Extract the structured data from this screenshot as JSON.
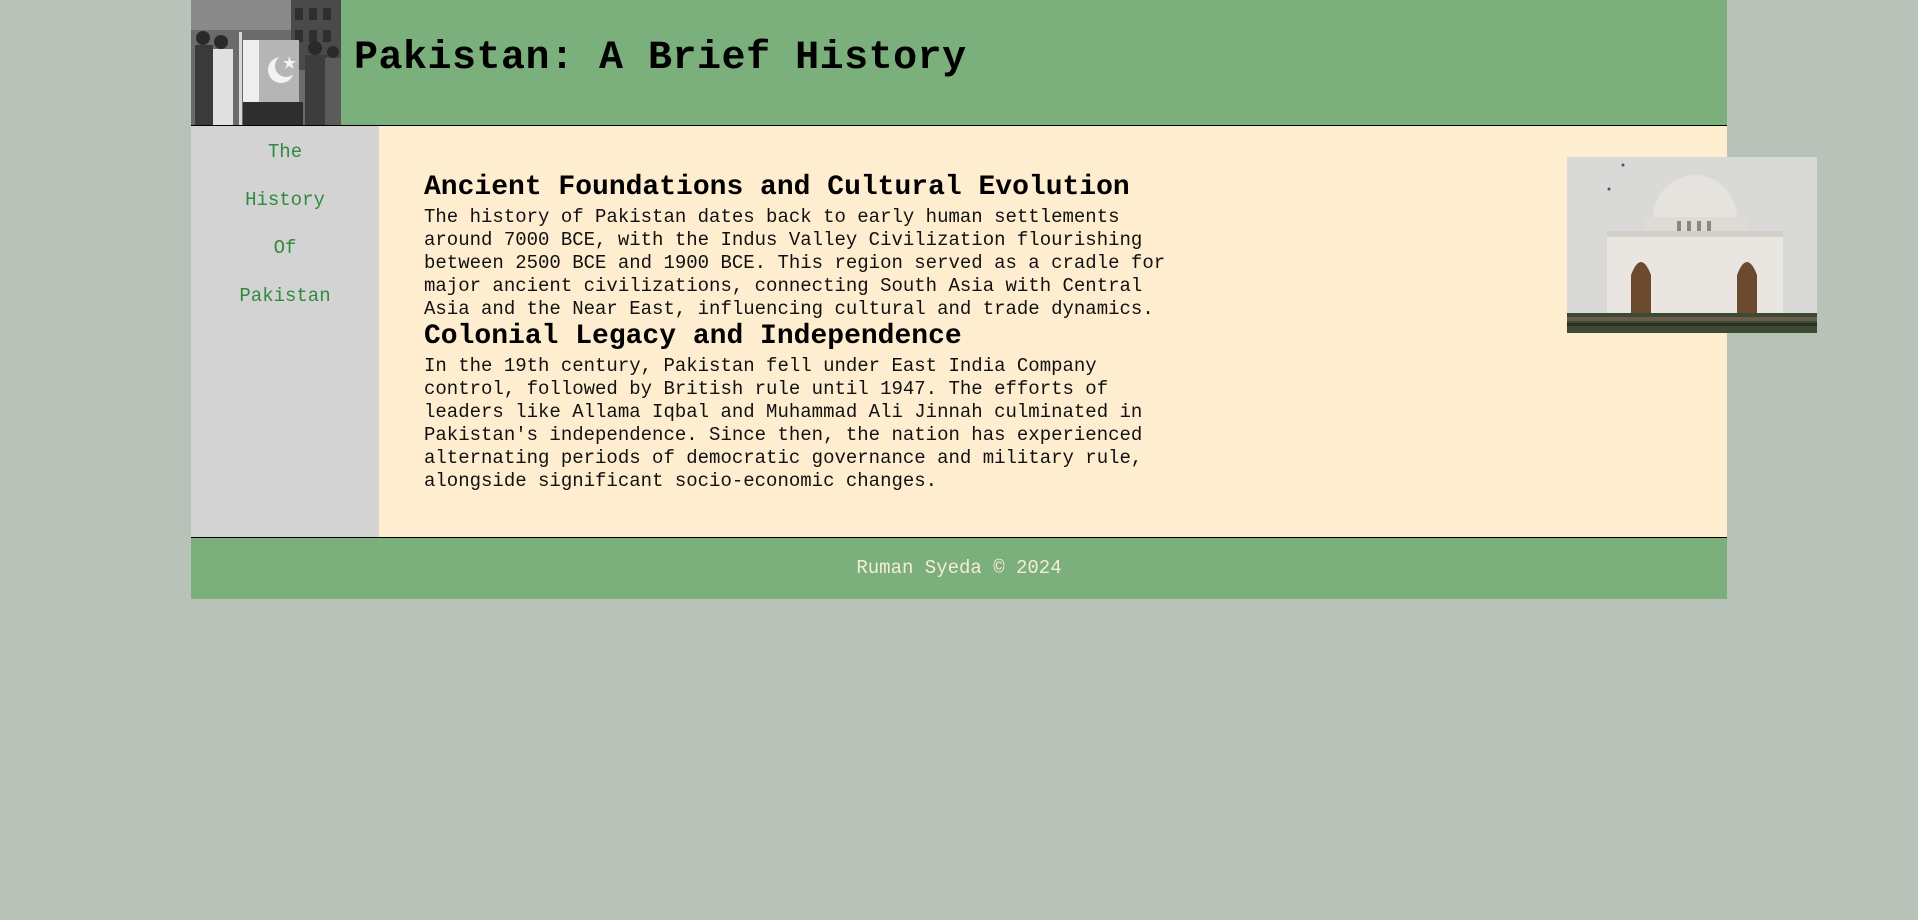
{
  "header": {
    "title": "Pakistan: A Brief History",
    "photo": "flag-raising-photo"
  },
  "sidebar": {
    "items": [
      {
        "label": "The"
      },
      {
        "label": "History"
      },
      {
        "label": "Of"
      },
      {
        "label": "Pakistan"
      }
    ]
  },
  "sections": [
    {
      "heading": "Ancient Foundations and Cultural Evolution",
      "lines": [
        "The history of Pakistan dates back to early human settlements",
        "around 7000 BCE, with the Indus Valley Civilization flourishing",
        "between 2500 BCE and 1900 BCE. This region served as a cradle for",
        "major ancient civilizations, connecting South Asia with Central",
        "Asia and the Near East, influencing cultural and trade dynamics."
      ]
    },
    {
      "heading": "Colonial Legacy and Independence",
      "lines": [
        "In the 19th century, Pakistan fell under East India Company",
        "control, followed by British rule until 1947. The efforts of",
        "leaders like Allama Iqbal and Muhammad Ali Jinnah culminated in",
        "Pakistan's independence. Since then, the nation has experienced",
        "alternating periods of democratic governance and military rule,",
        "alongside significant socio-economic changes."
      ]
    }
  ],
  "image": {
    "name": "mausoleum-photo"
  },
  "footer": {
    "text": "Ruman Syeda © 2024"
  },
  "colors": {
    "page_background": "#b8c2b8",
    "header_background": "#7baf7b",
    "sidebar_background": "#d3d3d3",
    "sidebar_link": "#2e8b3e",
    "content_background": "#ffedd0",
    "footer_text": "#f5eed0"
  }
}
